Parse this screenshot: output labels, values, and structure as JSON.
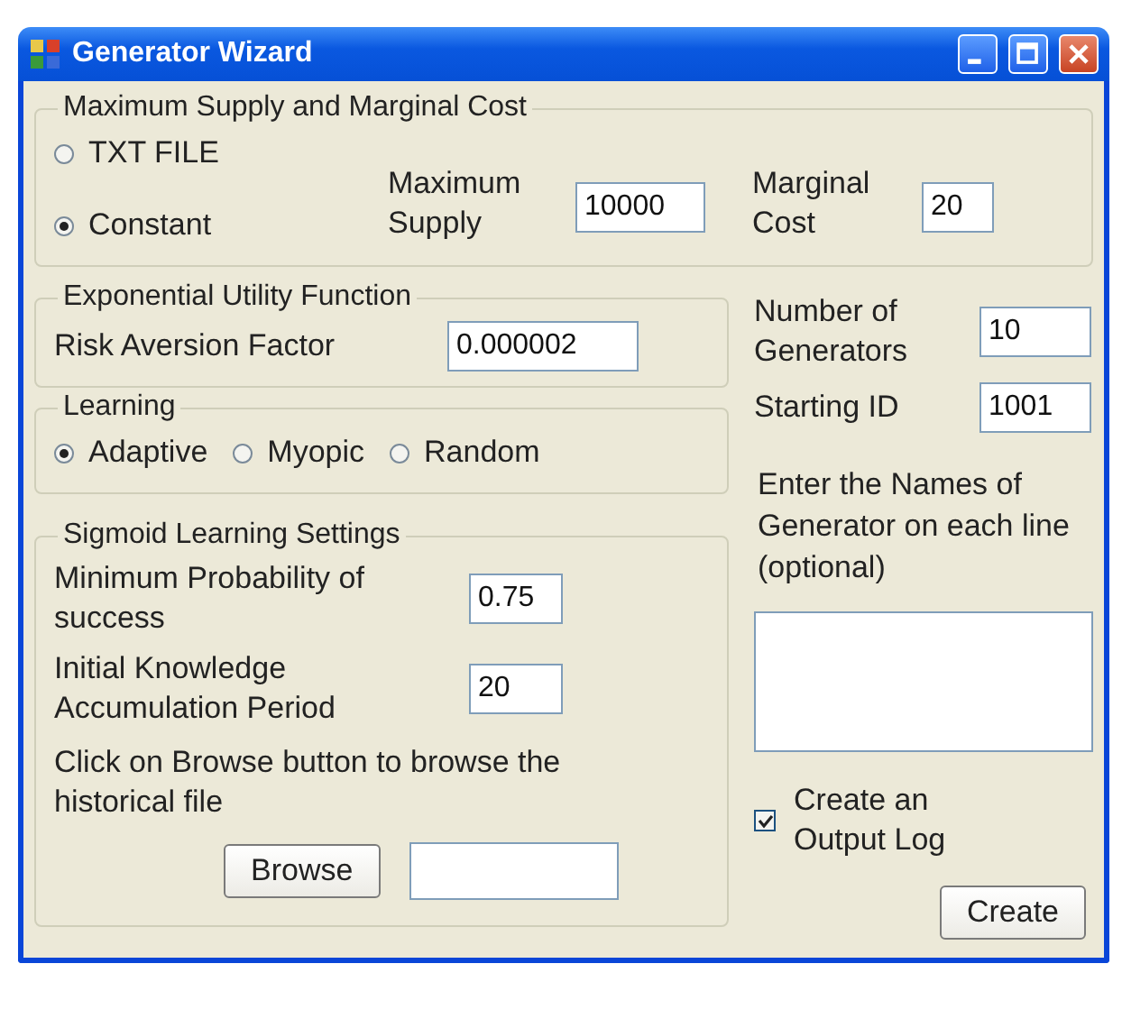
{
  "window": {
    "title": "Generator Wizard"
  },
  "supply_group": {
    "title": "Maximum Supply and Marginal Cost",
    "sources": [
      {
        "label": "TXT FILE",
        "selected": false
      },
      {
        "label": "Constant",
        "selected": true
      }
    ],
    "max_supply": {
      "label": "Maximum Supply",
      "value": "10000"
    },
    "marginal_cost": {
      "label": "Marginal Cost",
      "value": "20"
    }
  },
  "utility_group": {
    "title": "Exponential Utility Function",
    "risk_aversion": {
      "label": "Risk Aversion Factor",
      "value": "0.000002"
    }
  },
  "learning_group": {
    "title": "Learning",
    "options": [
      {
        "label": "Adaptive",
        "selected": true
      },
      {
        "label": "Myopic",
        "selected": false
      },
      {
        "label": "Random",
        "selected": false
      }
    ]
  },
  "sigmoid_group": {
    "title": "Sigmoid Learning Settings",
    "min_probability": {
      "label": "Minimum Probability of success",
      "value": "0.75"
    },
    "initial_period": {
      "label": "Initial Knowledge Accumulation Period",
      "value": "20"
    },
    "browse_hint": "Click on Browse button to browse the historical file",
    "browse_button": "Browse"
  },
  "generators": {
    "label": "Number of Generators",
    "value": "10"
  },
  "starting_id": {
    "label": "Starting ID",
    "value": "1001"
  },
  "names_hint": "Enter the Names of Generator on each line (optional)",
  "output_log": {
    "label": "Create an Output Log",
    "checked": true
  },
  "create_button": "Create"
}
